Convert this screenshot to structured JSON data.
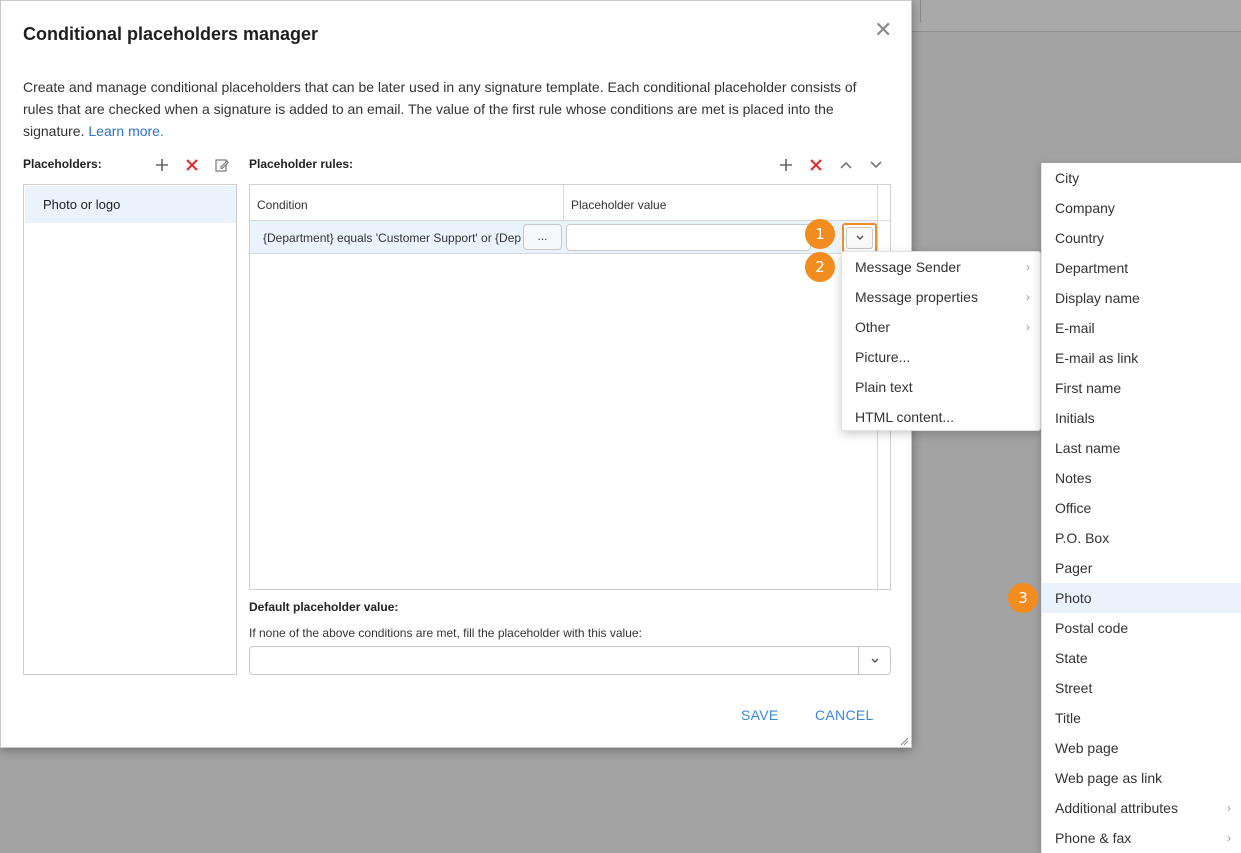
{
  "dialog": {
    "title": "Conditional placeholders manager",
    "close_glyph": "✕",
    "description": "Create and manage conditional placeholders that can be later used in any signature template. Each conditional placeholder consists of rules that are checked when a signature is added to an email. The value of the first rule whose conditions are met is placed into the signature.",
    "learn_more": "Learn more."
  },
  "placeholders": {
    "label": "Placeholders:",
    "items": [
      "Photo or logo"
    ]
  },
  "rules": {
    "label": "Placeholder rules:",
    "columns": [
      "Condition",
      "Placeholder value"
    ],
    "rows": [
      {
        "condition": "{Department} equals 'Customer Support' or {Department} equals 'Sales'",
        "dots": "...",
        "value": ""
      }
    ]
  },
  "default_value": {
    "label": "Default placeholder value:",
    "description": "If none of the above conditions are met, fill the placeholder with this value:",
    "value": ""
  },
  "actions": {
    "save": "SAVE",
    "cancel": "CANCEL"
  },
  "badges": [
    "1",
    "2",
    "3"
  ],
  "menu": {
    "items": [
      {
        "label": "Message Sender",
        "has_submenu": true
      },
      {
        "label": "Message properties",
        "has_submenu": true
      },
      {
        "label": "Other",
        "has_submenu": true
      },
      {
        "label": "Picture...",
        "has_submenu": false
      },
      {
        "label": "Plain text",
        "has_submenu": false
      },
      {
        "label": "HTML content...",
        "has_submenu": false
      }
    ],
    "chevron": "›"
  },
  "submenu": {
    "items": [
      "City",
      "Company",
      "Country",
      "Department",
      "Display name",
      "E-mail",
      "E-mail as link",
      "First name",
      "Initials",
      "Last name",
      "Notes",
      "Office",
      "P.O. Box",
      "Pager",
      "Photo",
      "Postal code",
      "State",
      "Street",
      "Title",
      "Web page",
      "Web page as link",
      "Additional attributes",
      "Phone & fax"
    ],
    "highlighted": "Photo",
    "with_submenu": [
      "Additional attributes",
      "Phone & fax"
    ]
  },
  "colors": {
    "accent": "#3b87d6",
    "badge": "#f28c1e",
    "delete": "#e02b2b",
    "selection": "#eaf3fc"
  }
}
